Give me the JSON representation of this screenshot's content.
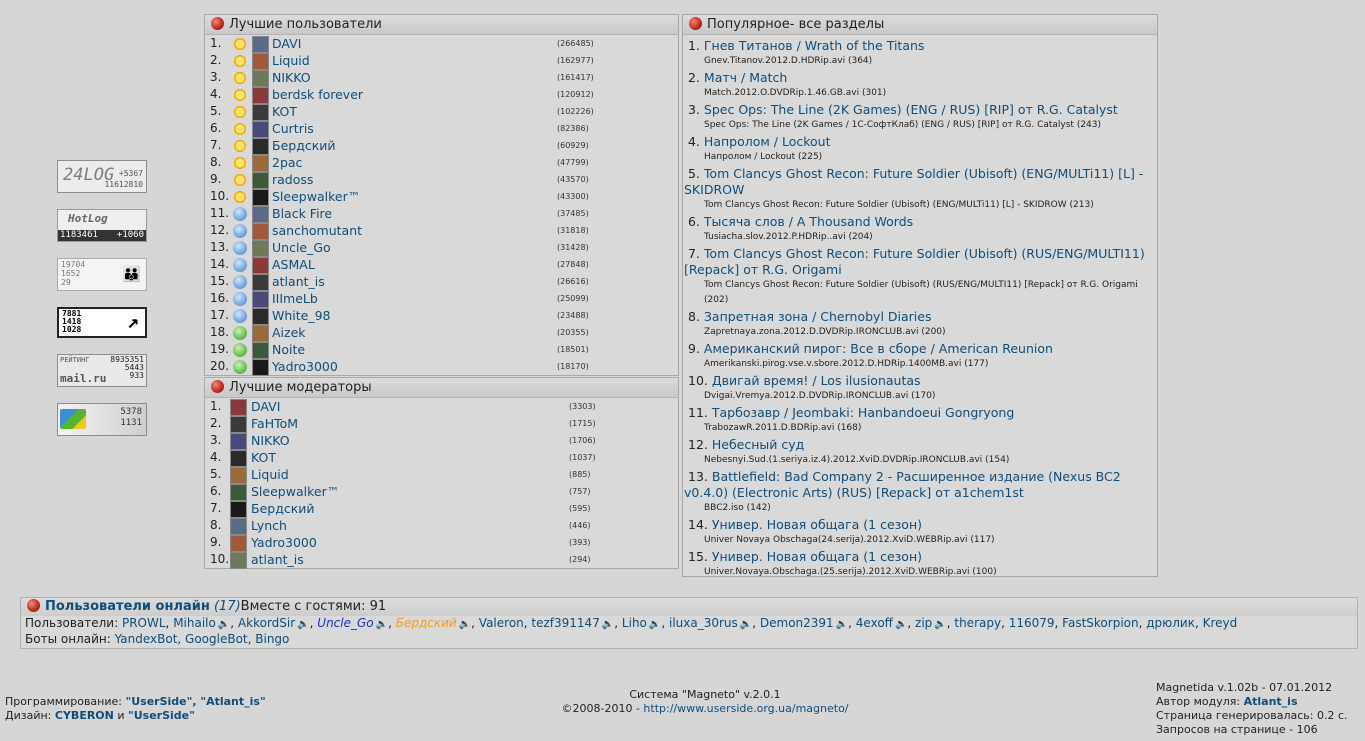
{
  "counters": {
    "log24": {
      "big": "24LOG",
      "a": "+5367",
      "b": "11612810"
    },
    "hotlog": {
      "brand": "HotLog",
      "total": "1183461",
      "delta": "+1060"
    },
    "liveinternet": {
      "a": "19704",
      "b": "1652",
      "c": "29"
    },
    "c4": {
      "a": "7881",
      "b": "1418",
      "c": "1028"
    },
    "mailru": {
      "label": "РЕЙТИНГ",
      "logo": "mail.ru",
      "a": "8935351",
      "b": "5443",
      "c": "933"
    },
    "c6": {
      "a": "5378",
      "b": "1131"
    }
  },
  "top_users": {
    "title": "Лучшие пользователи",
    "rows": [
      {
        "n": "1.",
        "name": "DAVI",
        "count": "(266485)",
        "rank": "sun"
      },
      {
        "n": "2.",
        "name": "Liquid",
        "count": "(162977)",
        "rank": "sun"
      },
      {
        "n": "3.",
        "name": "NIKKO",
        "count": "(161417)",
        "rank": "sun"
      },
      {
        "n": "4.",
        "name": "berdsk forever",
        "count": "(120912)",
        "rank": "sun"
      },
      {
        "n": "5.",
        "name": "KOT",
        "count": "(102226)",
        "rank": "sun"
      },
      {
        "n": "6.",
        "name": "Curtris",
        "count": "(82386)",
        "rank": "sun"
      },
      {
        "n": "7.",
        "name": "Бердский",
        "count": "(60929)",
        "rank": "sun"
      },
      {
        "n": "8.",
        "name": "2pac",
        "count": "(47799)",
        "rank": "sun"
      },
      {
        "n": "9.",
        "name": "radoss",
        "count": "(43570)",
        "rank": "sun"
      },
      {
        "n": "10.",
        "name": "Sleepwalker™",
        "count": "(43300)",
        "rank": "sun"
      },
      {
        "n": "11.",
        "name": "Black Fire",
        "count": "(37485)",
        "rank": "blue"
      },
      {
        "n": "12.",
        "name": "sanchomutant",
        "count": "(31818)",
        "rank": "blue"
      },
      {
        "n": "13.",
        "name": "Uncle_Go",
        "count": "(31428)",
        "rank": "blue"
      },
      {
        "n": "14.",
        "name": "ASMAL",
        "count": "(27848)",
        "rank": "blue"
      },
      {
        "n": "15.",
        "name": "atlant_is",
        "count": "(26616)",
        "rank": "blue"
      },
      {
        "n": "16.",
        "name": "IIImeLb",
        "count": "(25099)",
        "rank": "blue"
      },
      {
        "n": "17.",
        "name": "White_98",
        "count": "(23488)",
        "rank": "blue"
      },
      {
        "n": "18.",
        "name": "Aizek",
        "count": "(20355)",
        "rank": "green"
      },
      {
        "n": "19.",
        "name": "Noite",
        "count": "(18501)",
        "rank": "green"
      },
      {
        "n": "20.",
        "name": "Yadro3000",
        "count": "(18170)",
        "rank": "green"
      }
    ]
  },
  "top_mods": {
    "title": "Лучшие модераторы",
    "rows": [
      {
        "n": "1.",
        "name": "DAVI",
        "count": "(3303)"
      },
      {
        "n": "2.",
        "name": "FaHToM",
        "count": "(1715)"
      },
      {
        "n": "3.",
        "name": "NIKKO",
        "count": "(1706)"
      },
      {
        "n": "4.",
        "name": "KOT",
        "count": "(1037)"
      },
      {
        "n": "5.",
        "name": "Liquid",
        "count": "(885)"
      },
      {
        "n": "6.",
        "name": "Sleepwalker™",
        "count": "(757)"
      },
      {
        "n": "7.",
        "name": "Бердский",
        "count": "(595)"
      },
      {
        "n": "8.",
        "name": "Lynch",
        "count": "(446)"
      },
      {
        "n": "9.",
        "name": "Yadro3000",
        "count": "(393)"
      },
      {
        "n": "10.",
        "name": "atlant_is",
        "count": "(294)"
      }
    ]
  },
  "popular": {
    "title": "Популярное- все разделы",
    "items": [
      {
        "n": "1.",
        "title": "Гнев Титанов / Wrath of the Titans",
        "sub": "Gnev.Titanov.2012.D.HDRip.avi (364)"
      },
      {
        "n": "2.",
        "title": "Матч / Match",
        "sub": "Match.2012.O.DVDRip.1.46.GB.avi (301)"
      },
      {
        "n": "3.",
        "title": "Spec Ops: The Line (2K Games) (ENG / RUS) [RIP] от R.G. Catalyst",
        "sub": "Spec Ops: The Line (2K Games / 1С-СофтКлаб) (ENG / RUS) [RIP] от R.G. Catalyst (243)"
      },
      {
        "n": "4.",
        "title": "Напролом / Lockout",
        "sub": "Напролом / Lockout (225)"
      },
      {
        "n": "5.",
        "title": "Tom Clancys Ghost Recon: Future Soldier (Ubisoft) (ENG/MULTi11) [L] - SKIDROW",
        "sub": "Tom Clancys Ghost Recon: Future Soldier (Ubisoft) (ENG/MULTi11) [L] - SKIDROW (213)"
      },
      {
        "n": "6.",
        "title": "Тысяча слов / A Thousand Words",
        "sub": "Tusiacha.slov.2012.P.HDRip..avi (204)"
      },
      {
        "n": "7.",
        "title": "Tom Clancys Ghost Recon: Future Soldier (Ubisoft) (RUS/ENG/MULTI11) [Repack] от R.G. Origami",
        "sub": "Tom Clancys Ghost Recon: Future Soldier (Ubisoft) (RUS/ENG/MULTI11) [Repack] от R.G. Origami (202)"
      },
      {
        "n": "8.",
        "title": "Запретная зона / Chernobyl Diaries",
        "sub": "Zapretnaya.zona.2012.D.DVDRip.IRONCLUB.avi (200)"
      },
      {
        "n": "9.",
        "title": "Американский пирог: Все в сборе / American Reunion",
        "sub": "Amerikanski.pirog.vse.v.sbore.2012.D.HDRip.1400MB.avi (177)"
      },
      {
        "n": "10.",
        "title": "Двигай время! / Los ilusionautas",
        "sub": "Dvigai.Vremya.2012.D.DVDRip.IRONCLUB.avi (170)"
      },
      {
        "n": "11.",
        "title": "Тарбозавр / Jeombaki: Hanbandoeui Gongryong",
        "sub": "TrabozawR.2011.D.BDRip.avi (168)"
      },
      {
        "n": "12.",
        "title": "Небесный суд",
        "sub": "Nebesnyi.Sud.(1.seriya.iz.4).2012.XviD.DVDRip.IRONCLUB.avi (154)"
      },
      {
        "n": "13.",
        "title": "Battlefield: Bad Company 2 - Расширенное издание (Nexus BC2 v0.4.0) (Electronic Arts) (RUS) [Repack] от a1chem1st",
        "sub": "BBC2.iso (142)"
      },
      {
        "n": "14.",
        "title": "Универ. Новая общага (1 сезон)",
        "sub": "Univer Novaya Obschaga(24.serija).2012.XviD.WEBRip.avi (117)"
      },
      {
        "n": "15.",
        "title": "Универ. Новая общага (1 сезон)",
        "sub": "Univer.Novaya.Obschaga.(25.serija).2012.XviD.WEBRip.avi (100)"
      }
    ]
  },
  "online": {
    "title": "Пользователи онлайн",
    "count": "(17)",
    "guests": "Вместе с гостями: 91",
    "users_label": "Пользователи:",
    "users": [
      {
        "name": "PROWL",
        "sep": ", ",
        "spk": false,
        "style": ""
      },
      {
        "name": "Mihailo",
        "sep": " ",
        "spk": true,
        "style": ""
      },
      {
        "name": "AkkordSir",
        "sep": " ",
        "spk": true,
        "style": ""
      },
      {
        "name": "Uncle_Go",
        "sep": " ",
        "spk": true,
        "style": "blue"
      },
      {
        "name": "Бердский",
        "sep": " ",
        "spk": true,
        "style": "orange"
      },
      {
        "name": "Valeron",
        "sep": ", ",
        "spk": false,
        "style": ""
      },
      {
        "name": "tezf391147",
        "sep": " ",
        "spk": true,
        "style": ""
      },
      {
        "name": "Liho",
        "sep": " ",
        "spk": true,
        "style": ""
      },
      {
        "name": "iluxa_30rus",
        "sep": " ",
        "spk": true,
        "style": ""
      },
      {
        "name": "Demon2391",
        "sep": " ",
        "spk": true,
        "style": ""
      },
      {
        "name": "4exoff",
        "sep": " ",
        "spk": true,
        "style": ""
      },
      {
        "name": "zip",
        "sep": " ",
        "spk": true,
        "style": ""
      },
      {
        "name": "therapy",
        "sep": ", ",
        "spk": false,
        "style": ""
      },
      {
        "name": "116079",
        "sep": ", ",
        "spk": false,
        "style": ""
      },
      {
        "name": "FastSkorpion",
        "sep": ", ",
        "spk": false,
        "style": ""
      },
      {
        "name": "дрюлик",
        "sep": ", ",
        "spk": false,
        "style": ""
      },
      {
        "name": "Kreyd",
        "sep": "",
        "spk": false,
        "style": ""
      }
    ],
    "bots_label": "Боты онлайн:",
    "bots": "YandexBot, GoogleBot, Bingo"
  },
  "footer": {
    "prog_label": "Программирование:",
    "prog": "\"UserSide\", \"Atlant_is\"",
    "design_label": "Дизайн:",
    "design_a": "CYBERON",
    "design_and": "и",
    "design_b": "\"UserSide\"",
    "system": "Система \"Magneto\" v.2.0.1",
    "copyright": "©2008-2010 -",
    "url": "http://www.userside.org.ua/magneto/",
    "module": "Magnetida v.1.02b - 07.01.2012",
    "author_label": "Автор модуля:",
    "author": "Atlant_is",
    "gen": "Страница генерировалась: 0.2 с.",
    "queries": "Запросов на странице - 106"
  }
}
